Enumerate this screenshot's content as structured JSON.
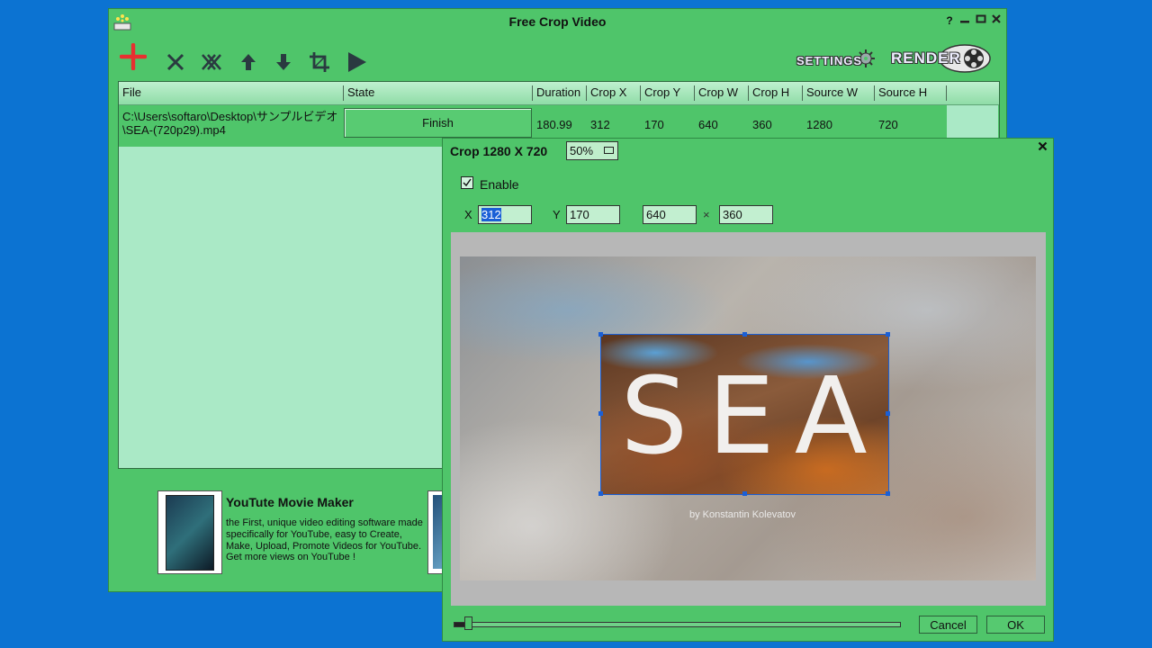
{
  "app": {
    "title": "Free Crop Video"
  },
  "window_controls": {
    "help": "?",
    "minimize": "▬",
    "maximize": "▣",
    "close": "✕"
  },
  "toolbar": {
    "icons": [
      "add-icon",
      "remove-icon",
      "remove-all-icon",
      "move-up-icon",
      "move-down-icon",
      "crop-icon",
      "play-icon"
    ],
    "settings_label": "SETTINGS",
    "render_label": "RENDER"
  },
  "table": {
    "columns": [
      "File",
      "State",
      "Duration",
      "Crop X",
      "Crop Y",
      "Crop W",
      "Crop H",
      "Source W",
      "Source H"
    ],
    "rows": [
      {
        "file": "C:\\Users\\softaro\\Desktop\\サンプルビデオ\\SEA-(720p29).mp4",
        "state": "Finish",
        "duration": "180.99",
        "crop_x": "312",
        "crop_y": "170",
        "crop_w": "640",
        "crop_h": "360",
        "source_w": "1280",
        "source_h": "720"
      }
    ]
  },
  "ad": {
    "title": "YouTute Movie Maker",
    "text": "the First, unique video editing software made specifically for YouTube, easy to Create, Make, Upload, Promote Videos for YouTube.",
    "link": "Get more views on YouTube !"
  },
  "crop_dialog": {
    "title": "Crop 1280 X 720",
    "zoom": "50%",
    "close": "✕",
    "enable_label": "Enable",
    "enable_checked": true,
    "x_label": "X",
    "x_value": "312",
    "y_label": "Y",
    "y_value": "170",
    "w_value": "640",
    "times": "×",
    "h_value": "360",
    "preview_text": "SEA",
    "preview_credit": "by Konstantin Kolevatov",
    "cancel_label": "Cancel",
    "ok_label": "OK"
  },
  "colors": {
    "background": "#0c73d2",
    "window": "#4fc56a",
    "list": "#aae9c6",
    "selection": "#1a5fd6"
  }
}
